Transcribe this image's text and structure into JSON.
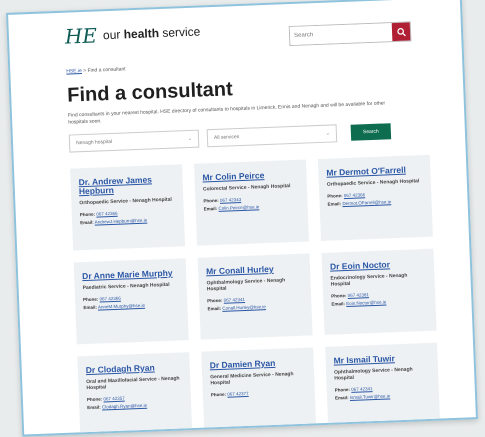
{
  "header": {
    "logo_mark": "HE",
    "logo_text_prefix": "our",
    "logo_text_bold": "health",
    "logo_text_suffix": "service",
    "search_placeholder": "Search"
  },
  "breadcrumb": {
    "home": "HSE.ie",
    "separator": ">",
    "current": "Find a consultant"
  },
  "page": {
    "title": "Find a consultant",
    "intro": "Find consultants in your nearest hospital. HSE directory of consultants to hospitals in Limerick, Ennis and Nenagh and will be available for other hospitals soon."
  },
  "filters": {
    "hospital": "Nenagh hospital",
    "service": "All services",
    "search_label": "Search"
  },
  "labels": {
    "phone": "Phone:",
    "email": "Email:"
  },
  "consultants": [
    {
      "name": "Dr. Andrew James Hepburn",
      "service": "Orthopaedic Service - Nenagh Hospital",
      "phone": "067 42366",
      "email": "AndrewJ.Hepburn@hse.ie"
    },
    {
      "name": "Mr Colin Peirce",
      "service": "Colorectal Service - Nenagh Hospital",
      "phone": "067 42343",
      "email": "Colin.Peirce@hse.ie"
    },
    {
      "name": "Mr Dermot O'Farrell",
      "service": "Orthopaedic Service - Nenagh Hospital",
      "phone": "067 42366",
      "email": "Dermot.OFarrell@hse.ie"
    },
    {
      "name": "Dr Anne Marie Murphy",
      "service": "Paediatric Service - Nenagh Hospital",
      "phone": "067 42366",
      "email": "AnneM.Murphy@hse.ie"
    },
    {
      "name": "Mr Conall Hurley",
      "service": "Ophthalmology Service - Nenagh Hospital",
      "phone": "067 42341",
      "email": "Conall.Hurley@hse.ie"
    },
    {
      "name": "Dr Eoin Noctor",
      "service": "Endocrinology Service - Nenagh Hospital",
      "phone": "067 42381",
      "email": "Eoin.Noctor@hse.ie"
    },
    {
      "name": "Dr Clodagh Ryan",
      "service": "Oral and Maxillofacial Service - Nenagh Hospital",
      "phone": "067 42357",
      "email": "Clodagh.Ryan@hse.ie"
    },
    {
      "name": "Dr Damien Ryan",
      "service": "General Medicine Service - Nenagh Hospital",
      "phone": "067 42377",
      "email": ""
    },
    {
      "name": "Mr Ismail Tuwir",
      "service": "Ophthalmology Service - Nenagh Hospital",
      "phone": "067 42341",
      "email": "Ismail.Tuwir@hse.ie"
    }
  ]
}
